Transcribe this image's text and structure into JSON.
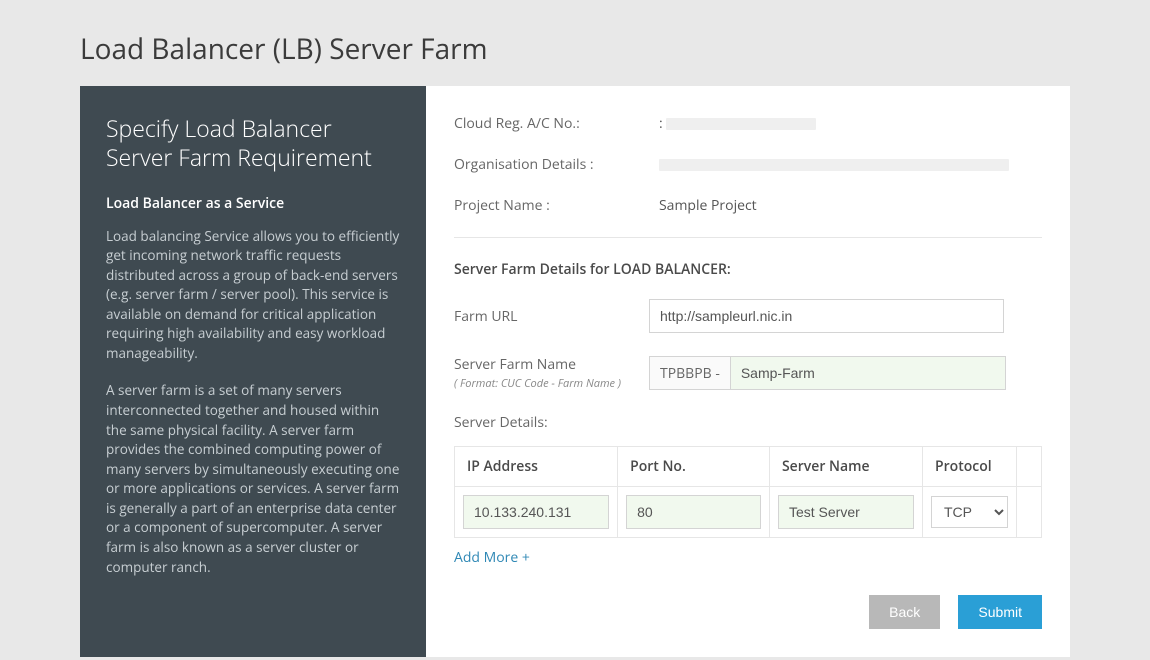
{
  "page": {
    "title": "Load Balancer (LB) Server Farm"
  },
  "sidebar": {
    "heading": "Specify Load Balancer Server Farm Requirement",
    "subheading": "Load Balancer as a Service",
    "para1": "Load balancing Service allows you to efficiently get incoming network traffic requests distributed across a group of back-end servers (e.g. server farm / server pool). This service is available on demand for critical application requiring high availability and easy workload manageability.",
    "para2": "A server farm is a set of many servers interconnected together and housed within the same physical facility. A server farm provides the combined computing power of many servers by simultaneously executing one or more applications or services. A server farm is generally a part of an enterprise data center or a component of supercomputer. A server farm is also known as a server cluster or computer ranch."
  },
  "info": {
    "cloud_reg_label": "Cloud Reg. A/C No.:",
    "cloud_reg_prefix": ":",
    "org_label": "Organisation Details :",
    "project_label": "Project Name :",
    "project_value": "Sample Project"
  },
  "form": {
    "section_title": "Server Farm Details for LOAD BALANCER:",
    "farm_url_label": "Farm URL",
    "farm_url_value": "http://sampleurl.nic.in",
    "farm_name_label": "Server Farm Name",
    "farm_name_hint": "( Format: CUC Code - Farm Name )",
    "farm_name_prefix": "TPBBPB -",
    "farm_name_value": "Samp-Farm",
    "server_details_label": "Server Details:",
    "table": {
      "headers": {
        "ip": "IP Address",
        "port": "Port No.",
        "server": "Server Name",
        "protocol": "Protocol"
      },
      "row": {
        "ip": "10.133.240.131",
        "port": "80",
        "server": "Test Server",
        "protocol": "TCP"
      }
    },
    "add_more": "Add More +"
  },
  "buttons": {
    "back": "Back",
    "submit": "Submit"
  }
}
